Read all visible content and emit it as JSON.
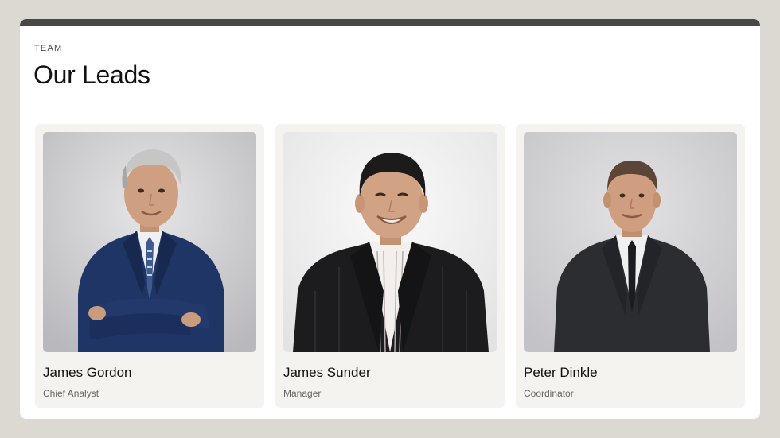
{
  "section": {
    "eyebrow": "TEAM",
    "title": "Our Leads"
  },
  "members": [
    {
      "name": "James Gordon",
      "role": "Chief Analyst",
      "photo": "portrait-gray-hair-navy-suit"
    },
    {
      "name": "James Sunder",
      "role": "Manager",
      "photo": "portrait-smiling-pinstripe-suit"
    },
    {
      "name": "Peter Dinkle",
      "role": "Coordinator",
      "photo": "portrait-dark-suit-tie"
    }
  ],
  "colors": {
    "page_background": "#dcd9d2",
    "top_bar": "#4a4847",
    "card_background": "#f4f3ef",
    "text_primary": "#111111",
    "text_secondary": "#666666"
  }
}
